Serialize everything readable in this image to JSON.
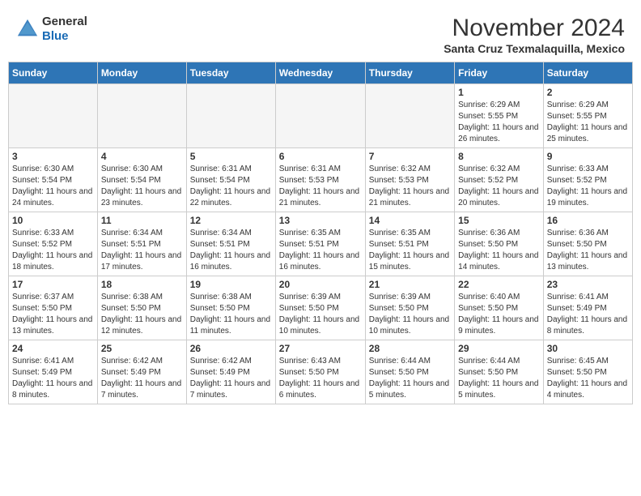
{
  "header": {
    "logo_general": "General",
    "logo_blue": "Blue",
    "month": "November 2024",
    "location": "Santa Cruz Texmalaquilla, Mexico"
  },
  "weekdays": [
    "Sunday",
    "Monday",
    "Tuesday",
    "Wednesday",
    "Thursday",
    "Friday",
    "Saturday"
  ],
  "weeks": [
    [
      {
        "day": "",
        "info": ""
      },
      {
        "day": "",
        "info": ""
      },
      {
        "day": "",
        "info": ""
      },
      {
        "day": "",
        "info": ""
      },
      {
        "day": "",
        "info": ""
      },
      {
        "day": "1",
        "info": "Sunrise: 6:29 AM\nSunset: 5:55 PM\nDaylight: 11 hours\nand 26 minutes."
      },
      {
        "day": "2",
        "info": "Sunrise: 6:29 AM\nSunset: 5:55 PM\nDaylight: 11 hours\nand 25 minutes."
      }
    ],
    [
      {
        "day": "3",
        "info": "Sunrise: 6:30 AM\nSunset: 5:54 PM\nDaylight: 11 hours\nand 24 minutes."
      },
      {
        "day": "4",
        "info": "Sunrise: 6:30 AM\nSunset: 5:54 PM\nDaylight: 11 hours\nand 23 minutes."
      },
      {
        "day": "5",
        "info": "Sunrise: 6:31 AM\nSunset: 5:54 PM\nDaylight: 11 hours\nand 22 minutes."
      },
      {
        "day": "6",
        "info": "Sunrise: 6:31 AM\nSunset: 5:53 PM\nDaylight: 11 hours\nand 21 minutes."
      },
      {
        "day": "7",
        "info": "Sunrise: 6:32 AM\nSunset: 5:53 PM\nDaylight: 11 hours\nand 21 minutes."
      },
      {
        "day": "8",
        "info": "Sunrise: 6:32 AM\nSunset: 5:52 PM\nDaylight: 11 hours\nand 20 minutes."
      },
      {
        "day": "9",
        "info": "Sunrise: 6:33 AM\nSunset: 5:52 PM\nDaylight: 11 hours\nand 19 minutes."
      }
    ],
    [
      {
        "day": "10",
        "info": "Sunrise: 6:33 AM\nSunset: 5:52 PM\nDaylight: 11 hours\nand 18 minutes."
      },
      {
        "day": "11",
        "info": "Sunrise: 6:34 AM\nSunset: 5:51 PM\nDaylight: 11 hours\nand 17 minutes."
      },
      {
        "day": "12",
        "info": "Sunrise: 6:34 AM\nSunset: 5:51 PM\nDaylight: 11 hours\nand 16 minutes."
      },
      {
        "day": "13",
        "info": "Sunrise: 6:35 AM\nSunset: 5:51 PM\nDaylight: 11 hours\nand 16 minutes."
      },
      {
        "day": "14",
        "info": "Sunrise: 6:35 AM\nSunset: 5:51 PM\nDaylight: 11 hours\nand 15 minutes."
      },
      {
        "day": "15",
        "info": "Sunrise: 6:36 AM\nSunset: 5:50 PM\nDaylight: 11 hours\nand 14 minutes."
      },
      {
        "day": "16",
        "info": "Sunrise: 6:36 AM\nSunset: 5:50 PM\nDaylight: 11 hours\nand 13 minutes."
      }
    ],
    [
      {
        "day": "17",
        "info": "Sunrise: 6:37 AM\nSunset: 5:50 PM\nDaylight: 11 hours\nand 13 minutes."
      },
      {
        "day": "18",
        "info": "Sunrise: 6:38 AM\nSunset: 5:50 PM\nDaylight: 11 hours\nand 12 minutes."
      },
      {
        "day": "19",
        "info": "Sunrise: 6:38 AM\nSunset: 5:50 PM\nDaylight: 11 hours\nand 11 minutes."
      },
      {
        "day": "20",
        "info": "Sunrise: 6:39 AM\nSunset: 5:50 PM\nDaylight: 11 hours\nand 10 minutes."
      },
      {
        "day": "21",
        "info": "Sunrise: 6:39 AM\nSunset: 5:50 PM\nDaylight: 11 hours\nand 10 minutes."
      },
      {
        "day": "22",
        "info": "Sunrise: 6:40 AM\nSunset: 5:50 PM\nDaylight: 11 hours\nand 9 minutes."
      },
      {
        "day": "23",
        "info": "Sunrise: 6:41 AM\nSunset: 5:49 PM\nDaylight: 11 hours\nand 8 minutes."
      }
    ],
    [
      {
        "day": "24",
        "info": "Sunrise: 6:41 AM\nSunset: 5:49 PM\nDaylight: 11 hours\nand 8 minutes."
      },
      {
        "day": "25",
        "info": "Sunrise: 6:42 AM\nSunset: 5:49 PM\nDaylight: 11 hours\nand 7 minutes."
      },
      {
        "day": "26",
        "info": "Sunrise: 6:42 AM\nSunset: 5:49 PM\nDaylight: 11 hours\nand 7 minutes."
      },
      {
        "day": "27",
        "info": "Sunrise: 6:43 AM\nSunset: 5:50 PM\nDaylight: 11 hours\nand 6 minutes."
      },
      {
        "day": "28",
        "info": "Sunrise: 6:44 AM\nSunset: 5:50 PM\nDaylight: 11 hours\nand 5 minutes."
      },
      {
        "day": "29",
        "info": "Sunrise: 6:44 AM\nSunset: 5:50 PM\nDaylight: 11 hours\nand 5 minutes."
      },
      {
        "day": "30",
        "info": "Sunrise: 6:45 AM\nSunset: 5:50 PM\nDaylight: 11 hours\nand 4 minutes."
      }
    ]
  ]
}
